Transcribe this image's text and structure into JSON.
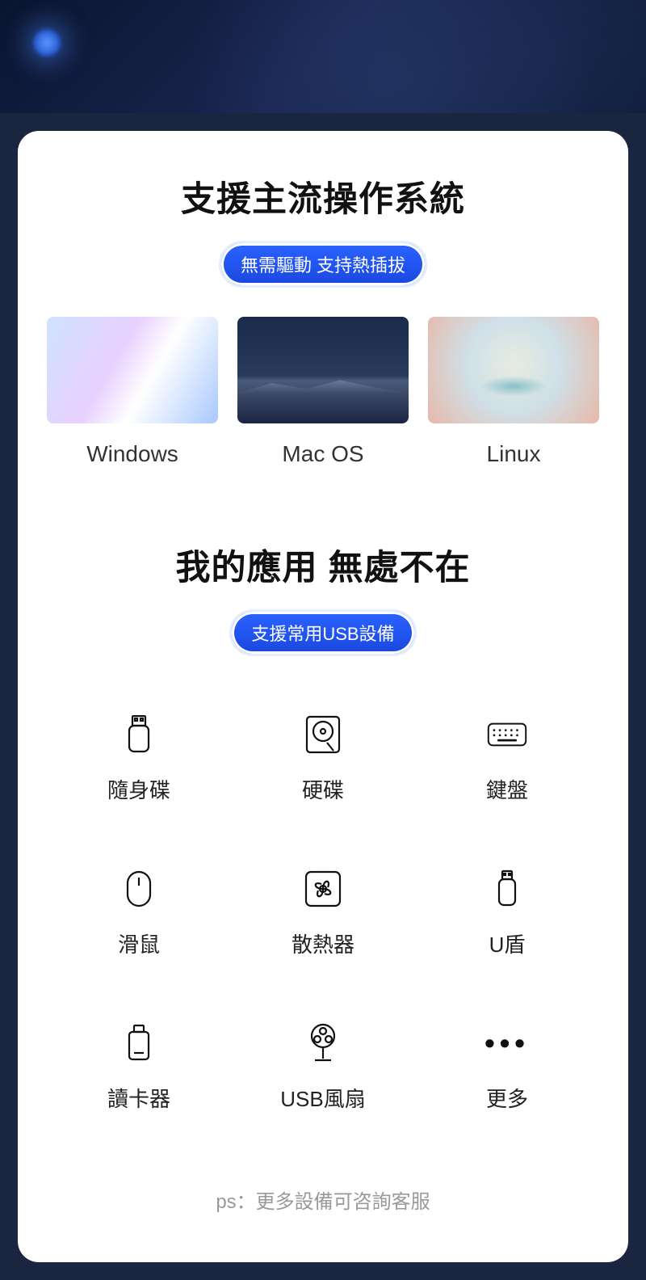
{
  "sections": {
    "os": {
      "title": "支援主流操作系統",
      "pill": "無需驅動 支持熱插拔",
      "items": [
        {
          "label": "Windows"
        },
        {
          "label": "Mac OS"
        },
        {
          "label": "Linux"
        }
      ]
    },
    "devices": {
      "title": "我的應用 無處不在",
      "pill": "支援常用USB設備",
      "items": [
        {
          "label": "隨身碟"
        },
        {
          "label": "硬碟"
        },
        {
          "label": "鍵盤"
        },
        {
          "label": "滑鼠"
        },
        {
          "label": "散熱器"
        },
        {
          "label": "U盾"
        },
        {
          "label": "讀卡器"
        },
        {
          "label": "USB風扇"
        },
        {
          "label": "更多"
        }
      ],
      "footnote": "ps：更多設備可咨詢客服"
    }
  }
}
